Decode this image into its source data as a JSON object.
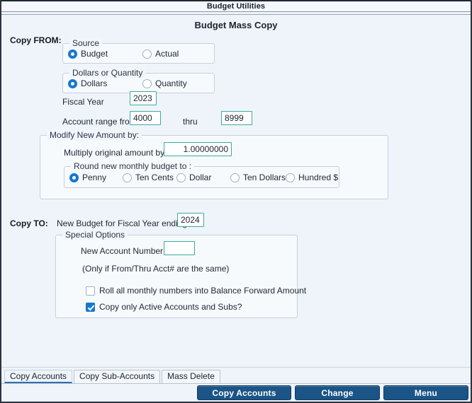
{
  "window": {
    "title": "Budget Utilities",
    "heading": "Budget Mass Copy"
  },
  "colors": {
    "background": "#eff4fb",
    "accent_blue": "#1479d0",
    "field_border": "#3aab9d",
    "button_blue": "#1b5486",
    "active_tab_underline": "#2f6fb5"
  },
  "copy_from": {
    "label": "Copy FROM:",
    "source_group": {
      "legend": "Source",
      "options": [
        {
          "label": "Budget",
          "checked": true
        },
        {
          "label": "Actual",
          "checked": false
        }
      ]
    },
    "dollars_quantity_group": {
      "legend": "Dollars or Quantity",
      "options": [
        {
          "label": "Dollars",
          "checked": true
        },
        {
          "label": "Quantity",
          "checked": false
        }
      ]
    },
    "fiscal_year": {
      "label": "Fiscal Year",
      "value": "2023"
    },
    "account_range": {
      "from_label": "Account range from:",
      "from_value": "4000",
      "thru_label": "thru",
      "thru_value": "8999"
    }
  },
  "modify": {
    "legend": "Modify New Amount by:",
    "multiply_label": "Multiply original amount by:",
    "multiply_value": "1.00000000",
    "round_group": {
      "legend": "Round new monthly budget to :",
      "options": [
        {
          "label": "Penny",
          "checked": true
        },
        {
          "label": "Ten Cents",
          "checked": false
        },
        {
          "label": "Dollar",
          "checked": false
        },
        {
          "label": "Ten Dollars",
          "checked": false
        },
        {
          "label": "Hundred $",
          "checked": false
        }
      ]
    }
  },
  "copy_to": {
    "label": "Copy TO:",
    "new_budget_label": "New Budget for Fiscal Year ending:",
    "new_budget_value": "2024",
    "special_options": {
      "legend": "Special Options",
      "new_account_label": "New Account Number:",
      "new_account_value": "",
      "new_account_note": "(Only if From/Thru Acct# are the same)",
      "checkboxes": [
        {
          "label": "Roll all monthly numbers into Balance Forward Amount",
          "checked": false
        },
        {
          "label": "Copy only Active Accounts and Subs?",
          "checked": true
        }
      ]
    }
  },
  "tabs": [
    {
      "label": "Copy Accounts",
      "active": true
    },
    {
      "label": "Copy Sub-Accounts",
      "active": false
    },
    {
      "label": "Mass Delete",
      "active": false
    }
  ],
  "buttons": [
    {
      "label": "Copy Accounts"
    },
    {
      "label": "Change"
    },
    {
      "label": "Menu"
    }
  ]
}
